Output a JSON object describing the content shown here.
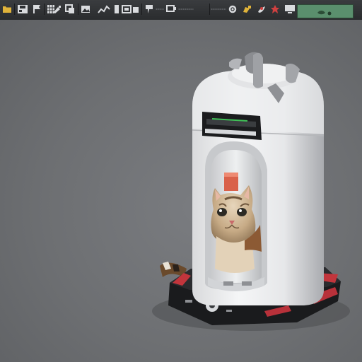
{
  "toolbar": {
    "tools": [
      {
        "icon": "folder-icon"
      },
      {
        "icon": "save-icon"
      },
      {
        "icon": "flag-icon"
      },
      {
        "icon": "grid-icon"
      },
      {
        "icon": "brush-icon"
      },
      {
        "icon": "copy-icon"
      },
      {
        "icon": "grid-icon"
      },
      {
        "icon": "image-icon"
      },
      {
        "icon": "chart-icon"
      },
      {
        "icon": "paint-icon"
      },
      {
        "icon": "layout-icon"
      },
      {
        "icon": "camera-icon"
      },
      {
        "icon": "screen-icon"
      },
      {
        "icon": "settings-icon"
      },
      {
        "icon": "rocket-icon"
      },
      {
        "icon": "map-icon"
      },
      {
        "icon": "plane-icon"
      },
      {
        "icon": "monitor-icon"
      }
    ],
    "colors": {
      "background": "#2e3033",
      "icon": "#d9dbde",
      "accent_yellow": "#e0b33a",
      "accent_red": "#d04040",
      "minimap": "#5a8f6d"
    }
  },
  "viewport": {
    "background": "#6f7174",
    "object": "cat-dispenser-model"
  }
}
